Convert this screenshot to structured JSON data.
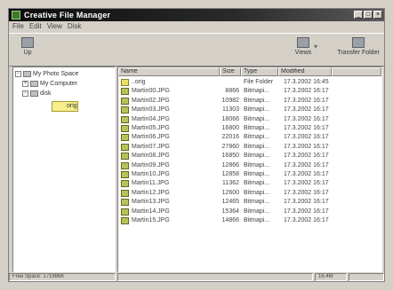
{
  "window": {
    "title": "Creative File Manager"
  },
  "menu": [
    "File",
    "Edit",
    "View",
    "Disk"
  ],
  "toolbar": {
    "left_button": "Up",
    "views_button": "Views",
    "transfer_button": "Transfer Folder"
  },
  "tree": {
    "root": "My Photo Space",
    "computer": "My Computer",
    "child": "disk",
    "selected": "orig"
  },
  "columns": [
    "Name",
    "Size",
    "Type",
    "Modified"
  ],
  "files": [
    {
      "name": "..orig",
      "size": "",
      "type": "File Folder",
      "modified": "17.3.2002 16:45"
    },
    {
      "name": "Martin00.JPG",
      "size": "8866",
      "type": "Bitmapi...",
      "modified": "17.3.2002 16:17"
    },
    {
      "name": "Martin02.JPG",
      "size": "10982",
      "type": "Bitmapi...",
      "modified": "17.3.2002 16:17"
    },
    {
      "name": "Martin03.JPG",
      "size": "11303",
      "type": "Bitmapi...",
      "modified": "17.3.2002 16:17"
    },
    {
      "name": "Martin04.JPG",
      "size": "18066",
      "type": "Bitmapi...",
      "modified": "17.3.2002 16:17"
    },
    {
      "name": "Martin05.JPG",
      "size": "16800",
      "type": "Bitmapi...",
      "modified": "17.3.2002 16:17"
    },
    {
      "name": "Martin06.JPG",
      "size": "22016",
      "type": "Bitmapi...",
      "modified": "17.3.2002 16:17"
    },
    {
      "name": "Martin07.JPG",
      "size": "27860",
      "type": "Bitmapi...",
      "modified": "17.3.2002 16:17"
    },
    {
      "name": "Martin08.JPG",
      "size": "16850",
      "type": "Bitmapi...",
      "modified": "17.3.2002 16:17"
    },
    {
      "name": "Martin09.JPG",
      "size": "12866",
      "type": "Bitmapi...",
      "modified": "17.3.2002 16:17"
    },
    {
      "name": "Martin10.JPG",
      "size": "12858",
      "type": "Bitmapi...",
      "modified": "17.3.2002 16:17"
    },
    {
      "name": "Martin11.JPG",
      "size": "11362",
      "type": "Bitmapi...",
      "modified": "17.3.2002 16:17"
    },
    {
      "name": "Martin12.JPG",
      "size": "12600",
      "type": "Bitmapi...",
      "modified": "17.3.2002 16:17"
    },
    {
      "name": "Martin13.JPG",
      "size": "12465",
      "type": "Bitmapi...",
      "modified": "17.3.2002 16:17"
    },
    {
      "name": "Martin14.JPG",
      "size": "15364",
      "type": "Bitmapi...",
      "modified": "17.3.2002 16:17"
    },
    {
      "name": "Martin15.JPG",
      "size": "14866",
      "type": "Bitmapi...",
      "modified": "17.3.2002 16:17"
    }
  ],
  "status": {
    "free_space": "Free Space: 171986K",
    "right": "16.4M"
  }
}
